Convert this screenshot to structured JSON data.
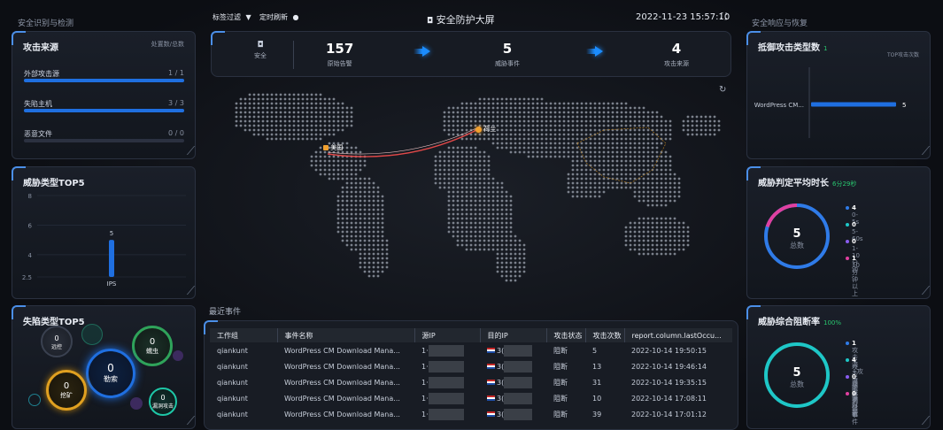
{
  "header": {
    "left_section_title": "安全识别与检测",
    "tag_filter": "标签过滤",
    "auto_refresh": "定时刷新",
    "title": "安全防护大屏",
    "datetime": "2022-11-23 15:57:10",
    "right_section_title": "安全响应与恢复"
  },
  "attack_sources": {
    "title": "攻击来源",
    "note": "处置数/总数",
    "items": [
      {
        "label": "外部攻击源",
        "value": "1 / 1",
        "ratio": 1.0
      },
      {
        "label": "失陷主机",
        "value": "3 / 3",
        "ratio": 1.0
      },
      {
        "label": "恶意文件",
        "value": "0 / 0",
        "ratio": 0.0
      }
    ]
  },
  "threat_top5": {
    "title": "威胁类型TOP5",
    "chart_data": {
      "type": "bar",
      "categories": [
        "IPS"
      ],
      "values": [
        5
      ],
      "ylim": [
        2.5,
        8
      ],
      "yticks": [
        "8",
        "6",
        "4",
        "2.5"
      ],
      "value_label": "5"
    }
  },
  "fallen_top5": {
    "title": "失陷类型TOP5",
    "bubbles": [
      {
        "value": "0",
        "label": "远控"
      },
      {
        "value": "0",
        "label": "蠕虫"
      },
      {
        "value": "0",
        "label": "勒索"
      },
      {
        "value": "0",
        "label": "挖矿"
      },
      {
        "value": "0",
        "label": "漏洞攻击"
      }
    ]
  },
  "summary": {
    "security_label": "安全",
    "stats": [
      {
        "num": "157",
        "label": "原始告警"
      },
      {
        "num": "5",
        "label": "威胁事件"
      },
      {
        "num": "4",
        "label": "攻击来源"
      }
    ]
  },
  "map": {
    "source_label": "美国",
    "target_label": "荷兰"
  },
  "events": {
    "title": "最近事件",
    "columns": [
      "工作组",
      "事件名称",
      "源IP",
      "目的IP",
      "攻击状态",
      "攻击次数",
      "report.column.lastOccu..."
    ],
    "rows": [
      {
        "group": "qiankunt",
        "name": "WordPress CM Download Mana...",
        "src": "1·",
        "dst": "3(",
        "status": "阻断",
        "count": "5",
        "time": "2022-10-14 19:50:15"
      },
      {
        "group": "qiankunt",
        "name": "WordPress CM Download Mana...",
        "src": "1·",
        "dst": "3(",
        "status": "阻断",
        "count": "13",
        "time": "2022-10-14 19:46:14"
      },
      {
        "group": "qiankunt",
        "name": "WordPress CM Download Mana...",
        "src": "1·",
        "dst": "3(",
        "status": "阻断",
        "count": "31",
        "time": "2022-10-14 19:35:15"
      },
      {
        "group": "qiankunt",
        "name": "WordPress CM Download Mana...",
        "src": "1·",
        "dst": "3(",
        "status": "阻断",
        "count": "10",
        "time": "2022-10-14 17:08:11"
      },
      {
        "group": "qiankunt",
        "name": "WordPress CM Download Mana...",
        "src": "1·",
        "dst": "3(",
        "status": "阻断",
        "count": "39",
        "time": "2022-10-14 17:01:12"
      }
    ]
  },
  "defense_types": {
    "title": "抵御攻击类型数",
    "note": "1",
    "axis_title": "TOP攻击次数",
    "chart_data": {
      "type": "bar",
      "categories": [
        "WordPress CM..."
      ],
      "values": [
        5
      ],
      "xlim": [
        0,
        5
      ]
    }
  },
  "judge_time": {
    "title": "威胁判定平均时长",
    "note": "6分29秒",
    "total": "5",
    "total_label": "总数",
    "legend": [
      {
        "value": "4",
        "label": "0-5s",
        "color": "#2f7be8"
      },
      {
        "value": "0",
        "label": "5-60s",
        "color": "#1ec7c7"
      },
      {
        "value": "0",
        "label": "1-10分钟",
        "color": "#8a5cf0"
      },
      {
        "value": "1",
        "label": "10分钟以上",
        "color": "#e040a0"
      }
    ]
  },
  "block_rate": {
    "title": "威胁综合阻断率",
    "note": "100%",
    "total": "5",
    "total_label": "总数",
    "legend": [
      {
        "value": "1",
        "label": "攻击流+攻击源双重拦截",
        "color": "#2f7be8"
      },
      {
        "value": "4",
        "label": "攻击流阻断",
        "color": "#1ec7c7"
      },
      {
        "value": "0",
        "label": "攻击源封禁",
        "color": "#8a5cf0"
      },
      {
        "value": "0",
        "label": "剩余事件",
        "color": "#e040a0"
      }
    ]
  }
}
